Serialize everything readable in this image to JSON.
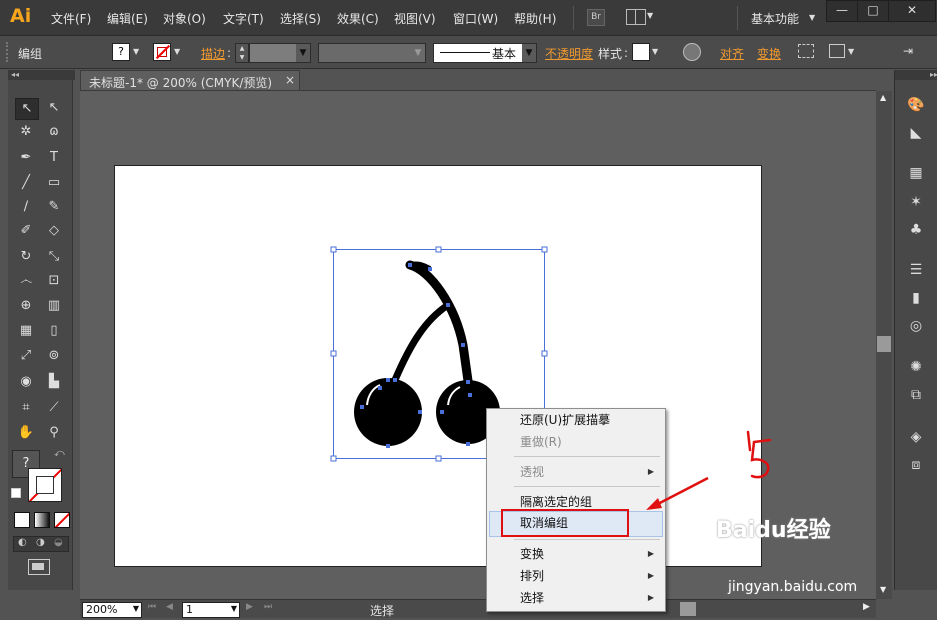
{
  "app": {
    "logo": "Ai"
  },
  "menu": [
    "文件(F)",
    "编辑(E)",
    "对象(O)",
    "文字(T)",
    "选择(S)",
    "效果(C)",
    "视图(V)",
    "窗口(W)",
    "帮助(H)"
  ],
  "menu_extra": {
    "bridge_label": "Br",
    "workspace": "基本功能"
  },
  "window_controls": {
    "minimize": "—",
    "maximize": "□",
    "close": "✕"
  },
  "control_bar": {
    "selection_label": "编组",
    "stroke_label": "描边",
    "stroke_profile": "基本",
    "opacity_label": "不透明度",
    "style_label": "样式",
    "align_label": "对齐",
    "transform_label": "变换"
  },
  "document_tab": {
    "title": "未标题-1* @ 200% (CMYK/预览)",
    "close": "×"
  },
  "status_bar": {
    "zoom": "200%",
    "page": "1",
    "status": "选择"
  },
  "context_menu": {
    "items": [
      {
        "label": "还原(U)扩展描摹",
        "disabled": false,
        "submenu": false
      },
      {
        "label": "重做(R)",
        "disabled": true,
        "submenu": false
      },
      {
        "label": "透视",
        "disabled": true,
        "submenu": true
      },
      {
        "label": "隔离选定的组",
        "disabled": false,
        "submenu": false
      },
      {
        "label": "取消编组",
        "disabled": false,
        "submenu": false,
        "highlighted": true
      },
      {
        "label": "变换",
        "disabled": false,
        "submenu": true
      },
      {
        "label": "排列",
        "disabled": false,
        "submenu": true
      },
      {
        "label": "选择",
        "disabled": false,
        "submenu": true
      }
    ]
  },
  "annotation": {
    "arrow_color": "#e01010",
    "scribble": "5"
  },
  "watermark": {
    "brand": "Baidu经验",
    "url": "jingyan.baidu.com"
  },
  "colors": {
    "accent": "#f7a51c",
    "orange_link": "#f29a2e",
    "selection_blue": "#4a6fd8",
    "highlight_red": "#e01010"
  }
}
